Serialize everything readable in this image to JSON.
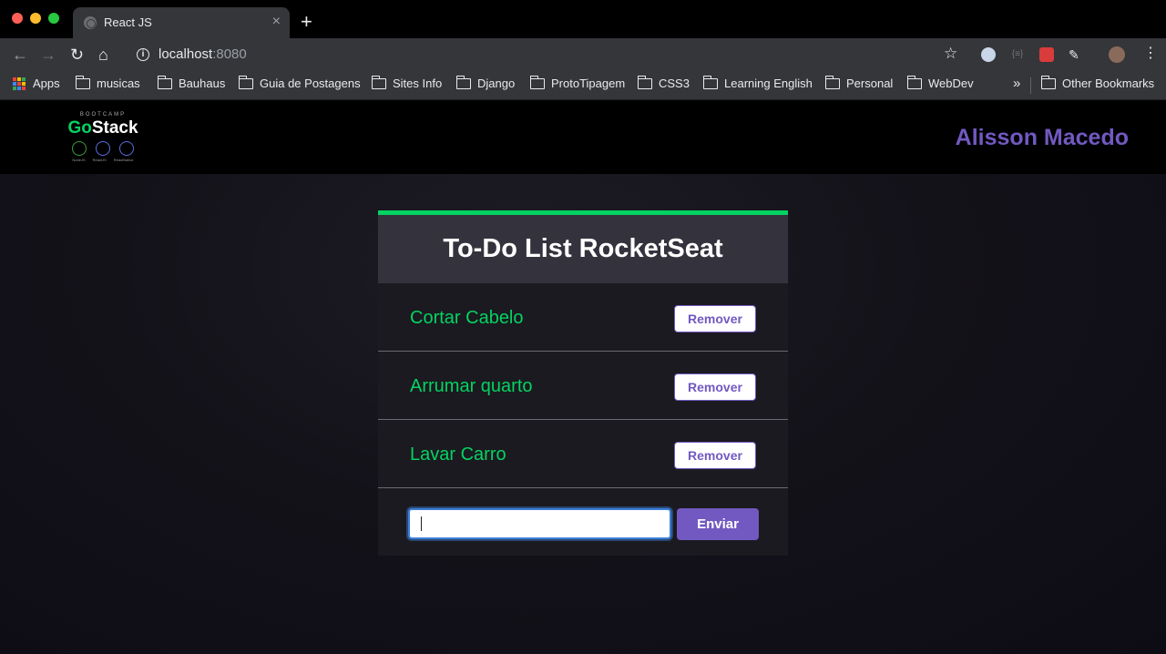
{
  "browser": {
    "tab_title": "React JS",
    "url_host": "localhost",
    "url_port": ":8080",
    "bookmarks": [
      "musicas",
      "Bauhaus",
      "Guia de Postagens",
      "Sites Info",
      "Django",
      "ProtoTipagem",
      "CSS3",
      "Learning English",
      "Personal",
      "WebDev"
    ],
    "apps_label": "Apps",
    "other_bookmarks": "Other Bookmarks"
  },
  "header": {
    "logo_bootcamp": "BOOTCAMP",
    "logo_go": "Go",
    "logo_stack": "Stack",
    "logo_techs": [
      "NodeJS",
      "ReactJS",
      "ReactNative"
    ],
    "user_name": "Alisson Macedo",
    "accent_color": "#7159c1"
  },
  "todo": {
    "title": "To-Do List RocketSeat",
    "items": [
      {
        "text": "Cortar Cabelo",
        "remove_label": "Remover"
      },
      {
        "text": "Arrumar quarto",
        "remove_label": "Remover"
      },
      {
        "text": "Lavar Carro",
        "remove_label": "Remover"
      }
    ],
    "input_value": "",
    "submit_label": "Enviar",
    "item_color": "#04d361",
    "top_border_color": "#04d361"
  }
}
